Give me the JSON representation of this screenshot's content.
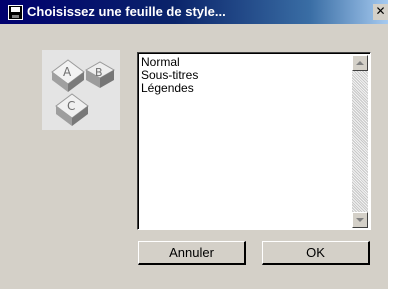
{
  "window": {
    "title": "Choisissez une feuille de style...",
    "close_glyph": "✕"
  },
  "style_list": {
    "items": [
      "Normal",
      "Sous-titres",
      "Légendes"
    ]
  },
  "buttons": {
    "cancel_label": "Annuler",
    "ok_label": "OK"
  },
  "icons": {
    "title_icon": "floppy-disk-icon",
    "illustration": "letter-blocks-icon"
  },
  "colors": {
    "titlebar_start": "#00006e",
    "titlebar_end": "#a6caf0",
    "dialog_bg": "#d4d0c8"
  }
}
